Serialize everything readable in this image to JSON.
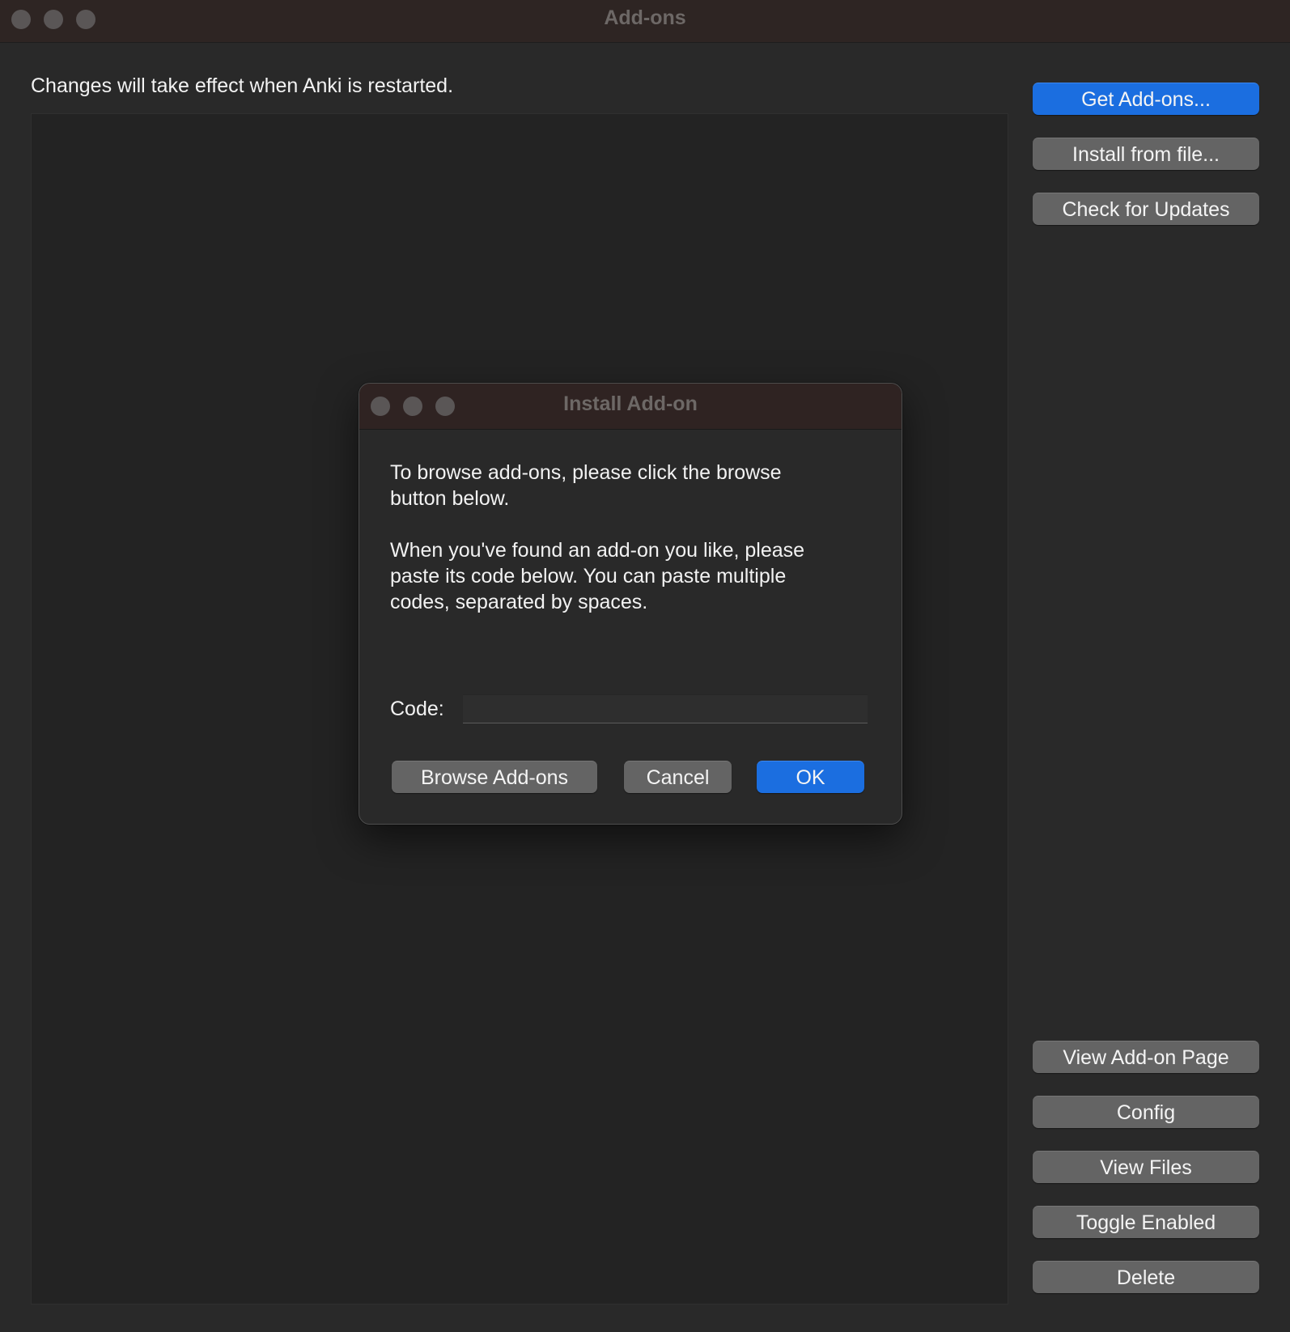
{
  "window": {
    "title": "Add-ons"
  },
  "main": {
    "notice": "Changes will take effect when Anki is restarted."
  },
  "sidebar": {
    "top_buttons": [
      {
        "label": "Get Add-ons..."
      },
      {
        "label": "Install from file..."
      },
      {
        "label": "Check for Updates"
      }
    ],
    "bottom_buttons": [
      {
        "label": "View Add-on Page"
      },
      {
        "label": "Config"
      },
      {
        "label": "View Files"
      },
      {
        "label": "Toggle Enabled"
      },
      {
        "label": "Delete"
      }
    ]
  },
  "dialog": {
    "title": "Install Add-on",
    "paragraph1_line1": "To browse add-ons, please click the browse",
    "paragraph1_line2": "button below.",
    "paragraph2_line1": "When you've found an add-on you like, please",
    "paragraph2_line2": "paste its code below. You can paste multiple",
    "paragraph2_line3": "codes, separated by spaces.",
    "code_label": "Code:",
    "code_value": "",
    "browse_label": "Browse Add-ons",
    "cancel_label": "Cancel",
    "ok_label": "OK"
  },
  "colors": {
    "accent": "#1b6ee0",
    "background": "#292929",
    "button": "#646464"
  }
}
